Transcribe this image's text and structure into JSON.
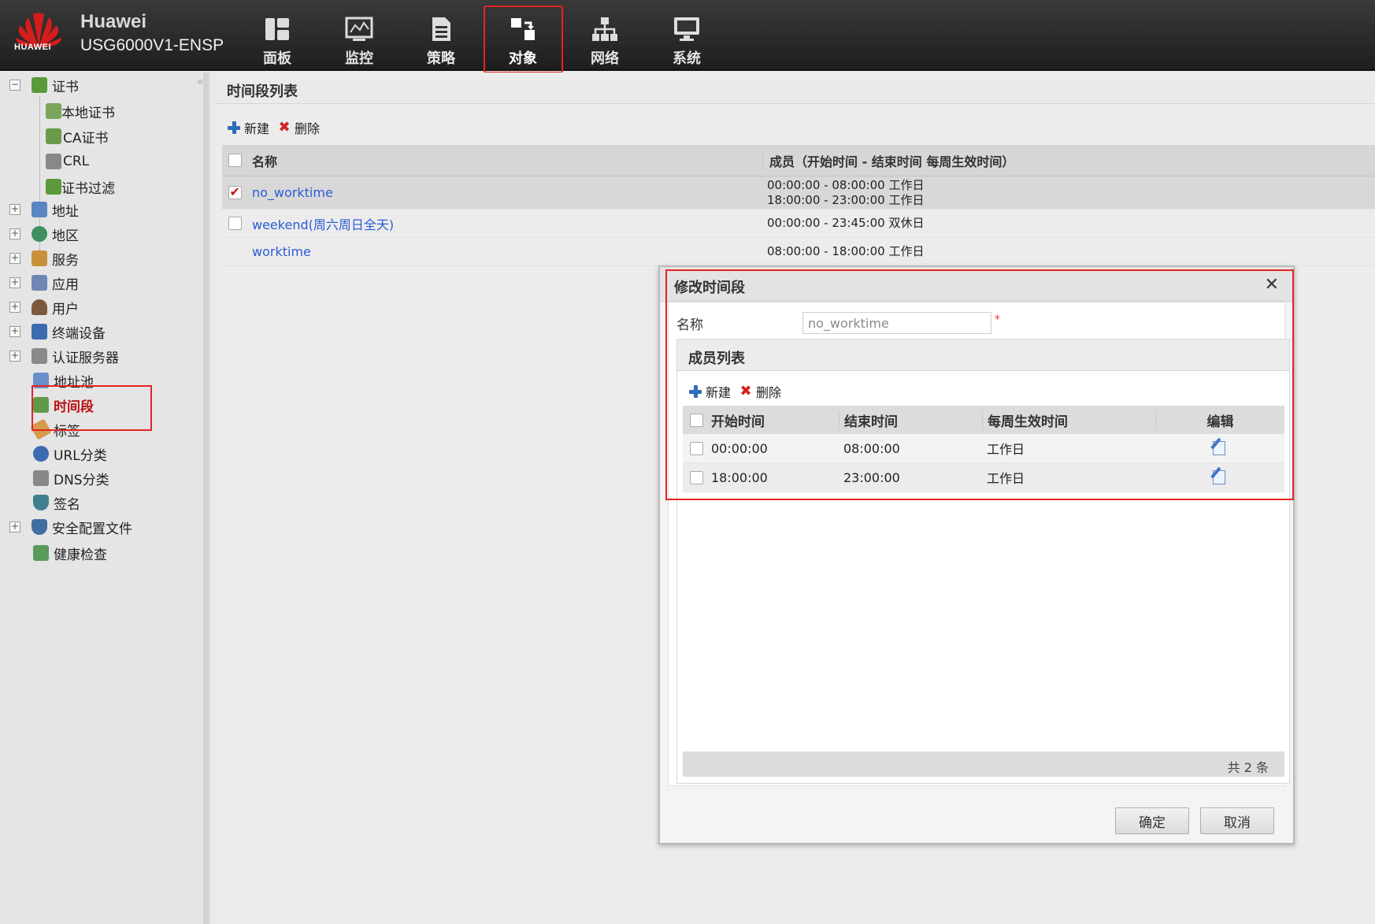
{
  "brand": {
    "logo_text": "HUAWEI",
    "vendor": "Huawei",
    "device": "USG6000V1-ENSP"
  },
  "nav": [
    {
      "label": "面板",
      "icon": "dashboard-icon"
    },
    {
      "label": "监控",
      "icon": "monitor-icon"
    },
    {
      "label": "策略",
      "icon": "policy-icon"
    },
    {
      "label": "对象",
      "icon": "object-icon",
      "active": true
    },
    {
      "label": "网络",
      "icon": "network-icon"
    },
    {
      "label": "系统",
      "icon": "system-icon"
    }
  ],
  "sidebar": {
    "items": [
      {
        "label": "证书",
        "expander": "−"
      },
      {
        "label": "本地证书"
      },
      {
        "label": "CA证书"
      },
      {
        "label": "CRL"
      },
      {
        "label": "证书过滤"
      },
      {
        "label": "地址",
        "expander": "+"
      },
      {
        "label": "地区",
        "expander": "+"
      },
      {
        "label": "服务",
        "expander": "+"
      },
      {
        "label": "应用",
        "expander": "+"
      },
      {
        "label": "用户",
        "expander": "+"
      },
      {
        "label": "终端设备",
        "expander": "+"
      },
      {
        "label": "认证服务器",
        "expander": "+"
      },
      {
        "label": "地址池"
      },
      {
        "label": "时间段",
        "selected": true
      },
      {
        "label": "标签"
      },
      {
        "label": "URL分类"
      },
      {
        "label": "DNS分类"
      },
      {
        "label": "签名"
      },
      {
        "label": "安全配置文件",
        "expander": "+"
      },
      {
        "label": "健康检查"
      }
    ]
  },
  "main": {
    "title": "时间段列表",
    "toolbar": {
      "new_label": "新建",
      "delete_label": "删除"
    },
    "columns": {
      "name": "名称",
      "member": "成员（开始时间 - 结束时间 每周生效时间）"
    },
    "rows": [
      {
        "name": "no_worktime",
        "member_lines": [
          "00:00:00 - 08:00:00 工作日",
          "18:00:00 - 23:00:00 工作日"
        ],
        "checked": true
      },
      {
        "name": "weekend(周六周日全天)",
        "member_lines": [
          "00:00:00 - 23:45:00 双休日"
        ],
        "checked": false
      },
      {
        "name": "worktime",
        "member_lines": [
          "08:00:00 - 18:00:00 工作日"
        ],
        "checked": false
      }
    ]
  },
  "modal": {
    "title": "修改时间段",
    "close": "✕",
    "name_label": "名称",
    "name_value": "no_worktime",
    "required_mark": "*",
    "member_list_title": "成员列表",
    "toolbar": {
      "new_label": "新建",
      "delete_label": "删除"
    },
    "columns": {
      "start": "开始时间",
      "end": "结束时间",
      "week": "每周生效时间",
      "edit": "编辑"
    },
    "rows": [
      {
        "start": "00:00:00",
        "end": "08:00:00",
        "week": "工作日"
      },
      {
        "start": "18:00:00",
        "end": "23:00:00",
        "week": "工作日"
      }
    ],
    "footer_count": "共 2 条",
    "ok_label": "确定",
    "cancel_label": "取消"
  },
  "colors": {
    "highlight": "#e52424",
    "link": "#2a5cd6",
    "selected_text": "#bb1111"
  }
}
